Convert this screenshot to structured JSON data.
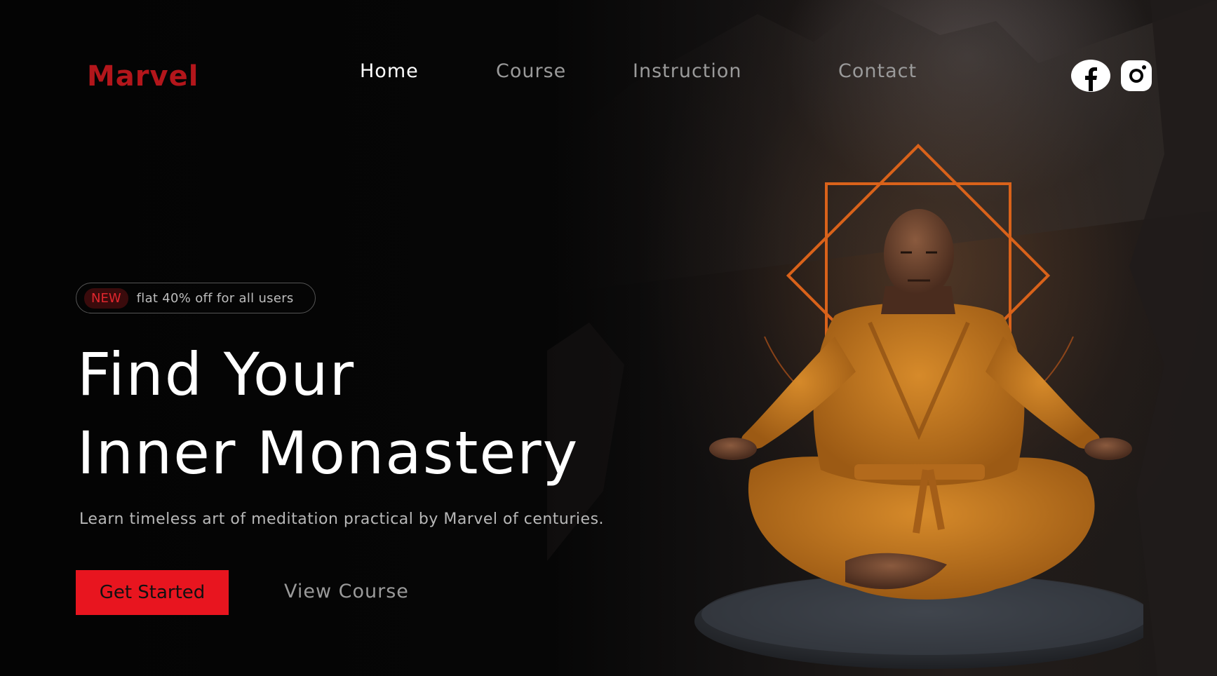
{
  "brand": {
    "name": "Marvel",
    "color": "#b3161b"
  },
  "nav": {
    "items": [
      {
        "label": "Home",
        "active": true
      },
      {
        "label": "Course",
        "active": false
      },
      {
        "label": "Instruction",
        "active": false
      },
      {
        "label": "Contact",
        "active": false
      }
    ]
  },
  "social": {
    "icons": [
      "facebook-icon",
      "instagram-icon"
    ]
  },
  "promo": {
    "badge": "NEW",
    "text": "flat 40% off for all users"
  },
  "hero": {
    "line1": "Find Your",
    "line2": "Inner Monastery",
    "subtitle": "Learn timeless art of meditation practical by Marvel  of centuries."
  },
  "buttons": {
    "primary": "Get Started",
    "secondary": "View Course"
  },
  "colors": {
    "accent": "#e8151f",
    "robe": "#c9781f",
    "ornament": "#d9621a",
    "background": "#050505"
  }
}
